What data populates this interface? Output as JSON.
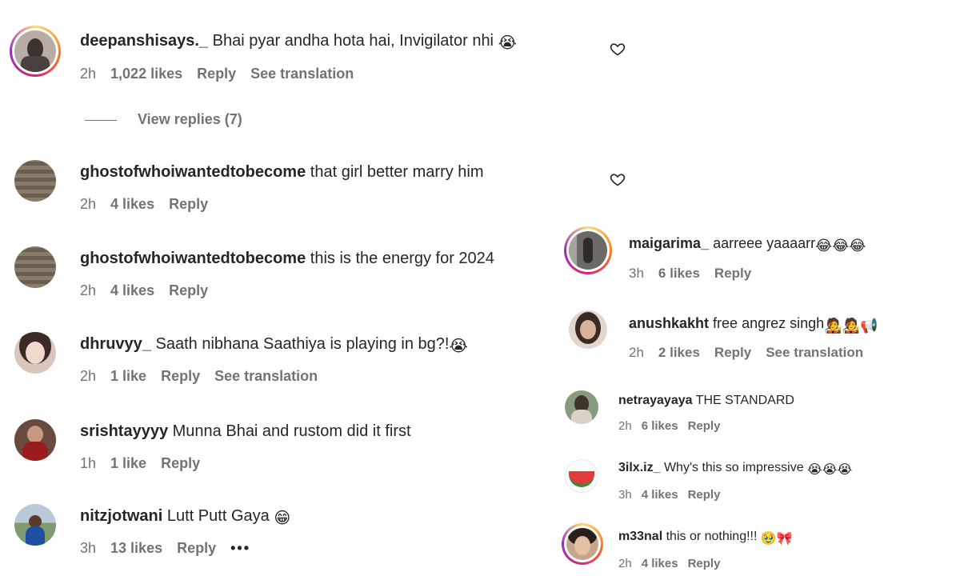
{
  "colors": {
    "text": "#262626",
    "muted": "#737373",
    "accent_ring": "#d62976"
  },
  "left_comments": [
    {
      "username": "deepanshisays._",
      "text": "Bhai pyar andha hota hai, Invigilator nhi",
      "emoji": "😭",
      "time": "2h",
      "likes": "1,022 likes",
      "reply": "Reply",
      "translate": "See translation"
    },
    {
      "username": "ghostofwhoiwantedtobecome",
      "text": "that girl better marry him",
      "time": "2h",
      "likes": "4 likes",
      "reply": "Reply"
    },
    {
      "username": "ghostofwhoiwantedtobecome",
      "text": "this is the energy for 2024",
      "time": "2h",
      "likes": "4 likes",
      "reply": "Reply"
    },
    {
      "username": "dhruvyy_",
      "text": "Saath nibhana Saathiya is playing in bg?!",
      "emoji": "😭",
      "time": "2h",
      "likes": "1 like",
      "reply": "Reply",
      "translate": "See translation"
    },
    {
      "username": "srishtayyyy",
      "text": "Munna Bhai and rustom did it first",
      "time": "1h",
      "likes": "1 like",
      "reply": "Reply"
    },
    {
      "username": "nitzjotwani",
      "text": "Lutt Putt Gaya",
      "emoji": "😁",
      "time": "3h",
      "likes": "13 likes",
      "reply": "Reply",
      "more": "•••"
    }
  ],
  "view_replies": "View replies (7)",
  "right_comments": [
    {
      "username": "maigarima_",
      "text": "aarreee yaaaarr",
      "emoji": "😂😂😂",
      "time": "3h",
      "likes": "6 likes",
      "reply": "Reply"
    },
    {
      "username": "anushkakht",
      "text": "free angrez singh",
      "emoji": "🧑‍🎤🧑‍🎤📢",
      "time": "2h",
      "likes": "2 likes",
      "reply": "Reply",
      "translate": "See translation"
    },
    {
      "username": "netrayayaya",
      "text": "THE STANDARD",
      "time": "2h",
      "likes": "6 likes",
      "reply": "Reply"
    },
    {
      "username": "3ilx.iz_",
      "text": "Why's this so impressive",
      "emoji": "😭😭😭",
      "time": "3h",
      "likes": "4 likes",
      "reply": "Reply"
    },
    {
      "username": "m33nal",
      "text": "this or nothing!!!",
      "emoji": "🥹🎀",
      "time": "2h",
      "likes": "4 likes",
      "reply": "Reply"
    }
  ]
}
